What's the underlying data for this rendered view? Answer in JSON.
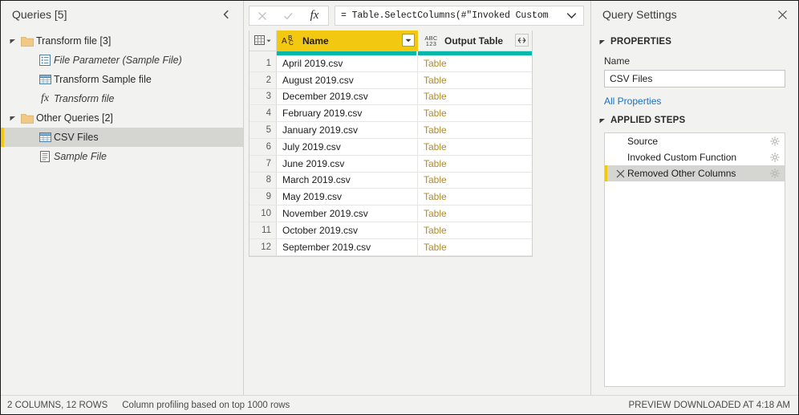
{
  "queries_pane": {
    "title": "Queries [5]",
    "collapse_icon": "chevron-left-icon",
    "tree": [
      {
        "label": "Transform file [3]",
        "icon": "folder-icon",
        "level": 0,
        "expander": "expanded",
        "italic": false,
        "selected": false
      },
      {
        "label": "File Parameter (Sample File)",
        "icon": "parameter-icon",
        "level": 1,
        "expander": "none",
        "italic": true,
        "selected": false
      },
      {
        "label": "Transform Sample file",
        "icon": "table-icon",
        "level": 1,
        "expander": "none",
        "italic": false,
        "selected": false
      },
      {
        "label": "Transform file",
        "icon": "function-fx-icon",
        "level": 1,
        "expander": "none",
        "italic": true,
        "selected": false
      },
      {
        "label": "Other Queries [2]",
        "icon": "folder-icon",
        "level": 0,
        "expander": "expanded",
        "italic": false,
        "selected": false
      },
      {
        "label": "CSV Files",
        "icon": "table-icon",
        "level": 1,
        "expander": "none",
        "italic": false,
        "selected": true
      },
      {
        "label": "Sample File",
        "icon": "document-icon",
        "level": 1,
        "expander": "none",
        "italic": true,
        "selected": false
      }
    ]
  },
  "formula_bar": {
    "cancel_icon": "close-x-icon",
    "accept_icon": "checkmark-icon",
    "fx_label": "fx",
    "formula": "= Table.SelectColumns(#\"Invoked Custom",
    "expand_icon": "chevron-down-icon"
  },
  "grid": {
    "select_all_icon": "select-all-table-icon",
    "columns": [
      {
        "name": "Name",
        "type_icon": "abc-text-type-icon",
        "header_button": "filter-dropdown-icon",
        "selected": true
      },
      {
        "name": "Output Table",
        "type_icon": "any-type-icon",
        "header_button": "expand-columns-icon",
        "selected": false
      }
    ],
    "quality_bar_color": "#01b8aa",
    "rows": [
      {
        "num": "1",
        "name": "April 2019.csv",
        "output": "Table"
      },
      {
        "num": "2",
        "name": "August 2019.csv",
        "output": "Table"
      },
      {
        "num": "3",
        "name": "December 2019.csv",
        "output": "Table"
      },
      {
        "num": "4",
        "name": "February 2019.csv",
        "output": "Table"
      },
      {
        "num": "5",
        "name": "January 2019.csv",
        "output": "Table"
      },
      {
        "num": "6",
        "name": "July 2019.csv",
        "output": "Table"
      },
      {
        "num": "7",
        "name": "June 2019.csv",
        "output": "Table"
      },
      {
        "num": "8",
        "name": "March 2019.csv",
        "output": "Table"
      },
      {
        "num": "9",
        "name": "May 2019.csv",
        "output": "Table"
      },
      {
        "num": "10",
        "name": "November 2019.csv",
        "output": "Table"
      },
      {
        "num": "11",
        "name": "October 2019.csv",
        "output": "Table"
      },
      {
        "num": "12",
        "name": "September 2019.csv",
        "output": "Table"
      }
    ]
  },
  "query_settings": {
    "title": "Query Settings",
    "close_icon": "close-x-icon",
    "properties": {
      "section_title": "PROPERTIES",
      "name_label": "Name",
      "name_value": "CSV Files",
      "all_properties_link": "All Properties"
    },
    "applied_steps": {
      "section_title": "APPLIED STEPS",
      "steps": [
        {
          "label": "Source",
          "selected": false,
          "has_delete": false,
          "gear_icon": "gear-icon"
        },
        {
          "label": "Invoked Custom Function",
          "selected": false,
          "has_delete": false,
          "gear_icon": "gear-icon"
        },
        {
          "label": "Removed Other Columns",
          "selected": true,
          "has_delete": true,
          "gear_icon": "gear-icon"
        }
      ]
    }
  },
  "status_bar": {
    "dimensions": "2 COLUMNS, 12 ROWS",
    "profiling": "Column profiling based on top 1000 rows",
    "preview_status": "PREVIEW DOWNLOADED AT 4:18 AM"
  },
  "colors": {
    "accent_gold": "#f2c811",
    "quality_teal": "#01b8aa",
    "link_blue": "#1a6fc4",
    "table_link": "#b08a28",
    "pane_bg": "#f2f2f0"
  }
}
